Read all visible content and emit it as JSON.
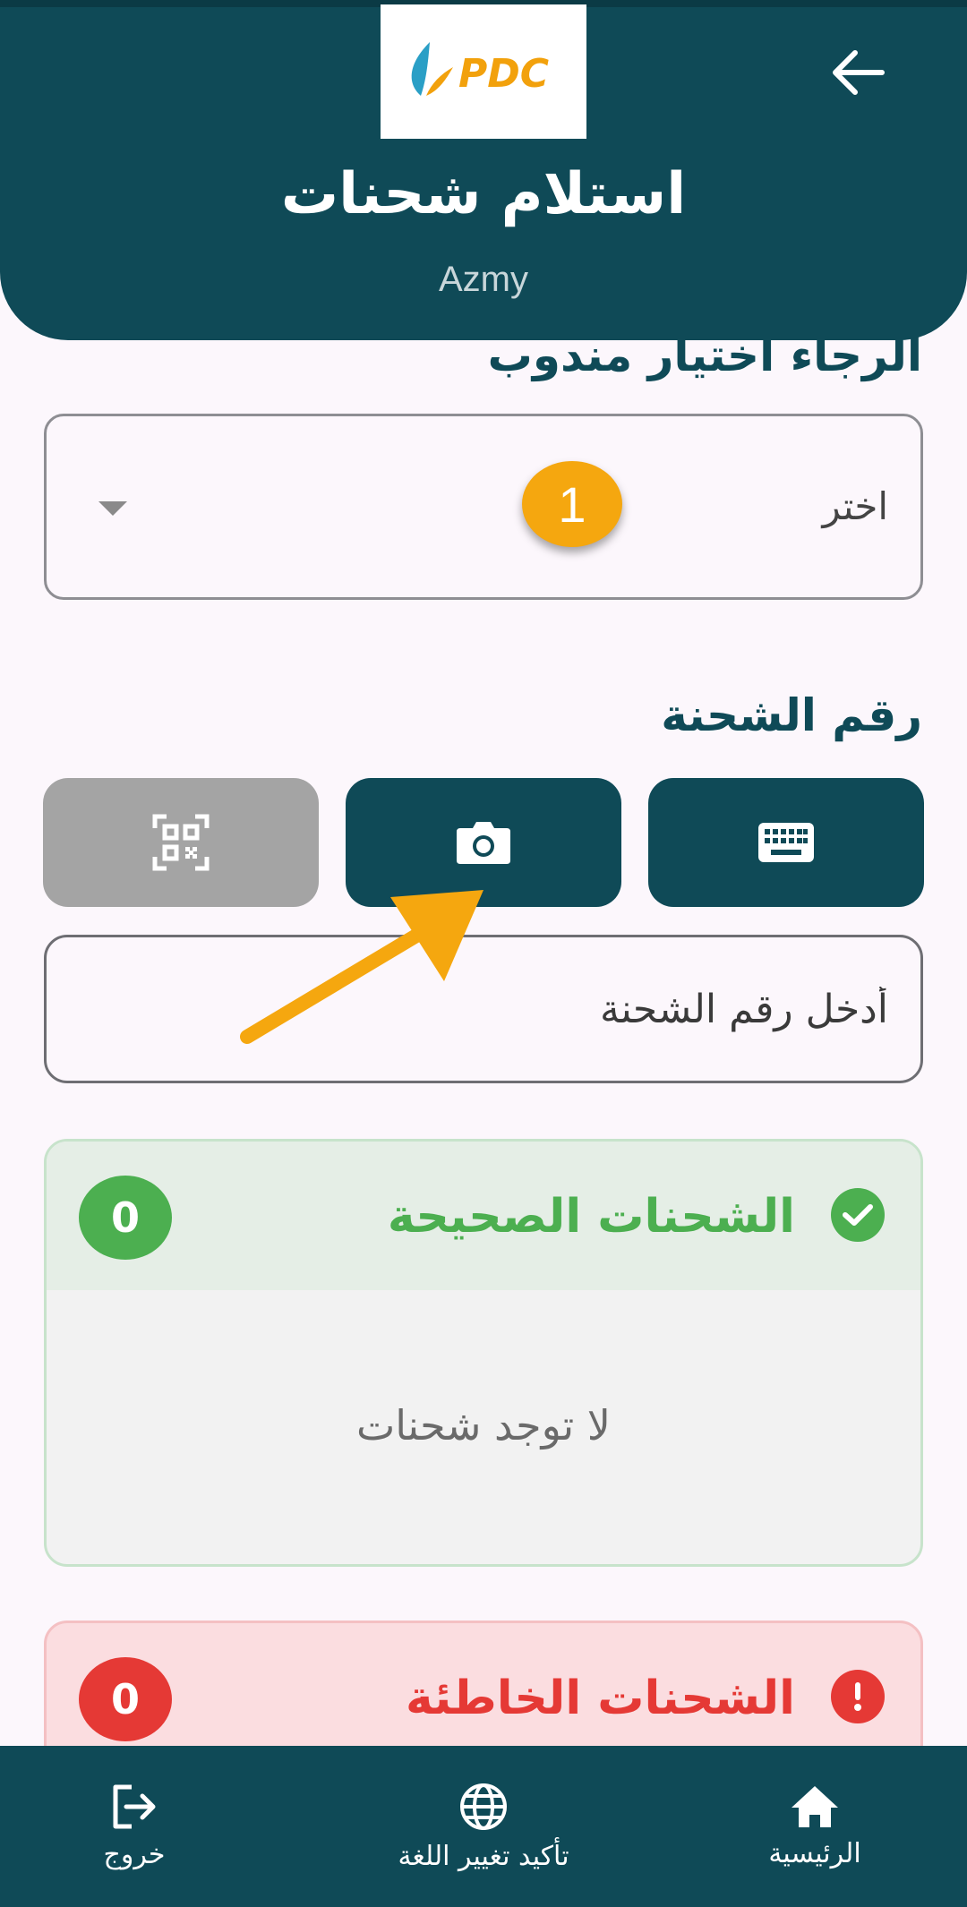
{
  "header": {
    "logo_text": "PDC",
    "title": "استلام شحنات",
    "user": "Azmy"
  },
  "representative": {
    "heading": "الرجاء اختيار مندوب",
    "dropdown_value": "اختر",
    "step_number": "1"
  },
  "shipment": {
    "heading": "رقم الشحنة",
    "input_placeholder": "أدخل رقم الشحنة",
    "modes": [
      "keyboard",
      "camera",
      "qr-scanner"
    ]
  },
  "valid_shipments": {
    "title": "الشحنات الصحيحة",
    "count": "0",
    "empty_text": "لا توجد شحنات",
    "color": "#4caf50"
  },
  "invalid_shipments": {
    "title": "الشحنات الخاطئة",
    "count": "0",
    "color": "#e53935"
  },
  "bottom_nav": {
    "home": "الرئيسية",
    "language": "تأكيد تغيير اللغة",
    "exit": "خروج"
  },
  "colors": {
    "primary": "#0f4a57",
    "accent": "#f5a70f",
    "background": "#fcf7fc"
  }
}
